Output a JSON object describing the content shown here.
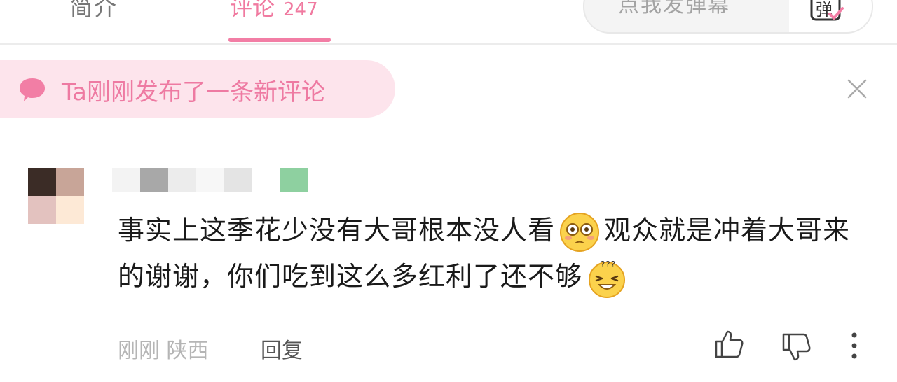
{
  "tabs": {
    "intro_label": "简介",
    "comments_label": "评论",
    "comments_count": "247"
  },
  "danmu": {
    "input_placeholder": "点我发弹幕",
    "toggle_label": "弹"
  },
  "notice": {
    "text": "Ta刚刚发布了一条新评论",
    "icon": "chat-bubble-icon"
  },
  "comment": {
    "text_part1": "事实上这季花少没有大哥根本没人看",
    "text_part2": "观众就是冲着大哥来的谢谢，你们吃到这么多红利了还不够",
    "emoji1": "flushed-emoji",
    "emoji2": "confused-emoji",
    "time": "刚刚 陕西",
    "reply_label": "回复"
  },
  "icons": {
    "close": "close-icon",
    "like": "thumbs-up-icon",
    "dislike": "thumbs-down-icon",
    "more": "more-vertical-icon"
  },
  "colors": {
    "accent_pink": "#f27ea5",
    "notice_bg": "#fde4ec",
    "text_primary": "#1a1a1a",
    "text_meta": "#b5b5b5"
  }
}
